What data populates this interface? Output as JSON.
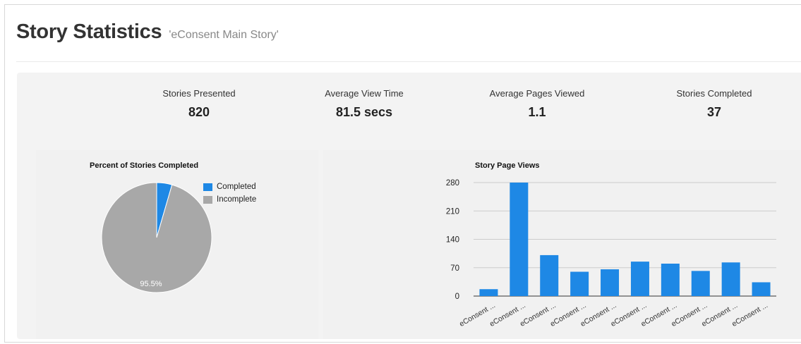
{
  "header": {
    "title": "Story Statistics",
    "subtitle": "'eConsent Main Story'"
  },
  "stats": [
    {
      "label": "Stories Presented",
      "value": "820"
    },
    {
      "label": "Average View Time",
      "value": "81.5 secs"
    },
    {
      "label": "Average Pages Viewed",
      "value": "1.1"
    },
    {
      "label": "Stories Completed",
      "value": "37"
    }
  ],
  "colors": {
    "completed": "#1e88e5",
    "incomplete": "#a8a8a8",
    "bar": "#1e88e5"
  },
  "chart_data": [
    {
      "type": "pie",
      "title": "Percent of Stories Completed",
      "categories": [
        "Completed",
        "Incomplete"
      ],
      "values": [
        4.5,
        95.5
      ],
      "slice_labels": [
        "",
        "95.5%"
      ],
      "legend_position": "right"
    },
    {
      "type": "bar",
      "title": "Story Page Views",
      "categories": [
        "eConsent ...",
        "eConsent ...",
        "eConsent ...",
        "eConsent ...",
        "eConsent ...",
        "eConsent ...",
        "eConsent ...",
        "eConsent ...",
        "eConsent ...",
        "eConsent ..."
      ],
      "values": [
        17,
        280,
        101,
        60,
        66,
        85,
        80,
        62,
        83,
        34
      ],
      "ylim": [
        0,
        280
      ],
      "yticks": [
        "0",
        "70",
        "140",
        "210",
        "280"
      ],
      "grid": true
    }
  ]
}
